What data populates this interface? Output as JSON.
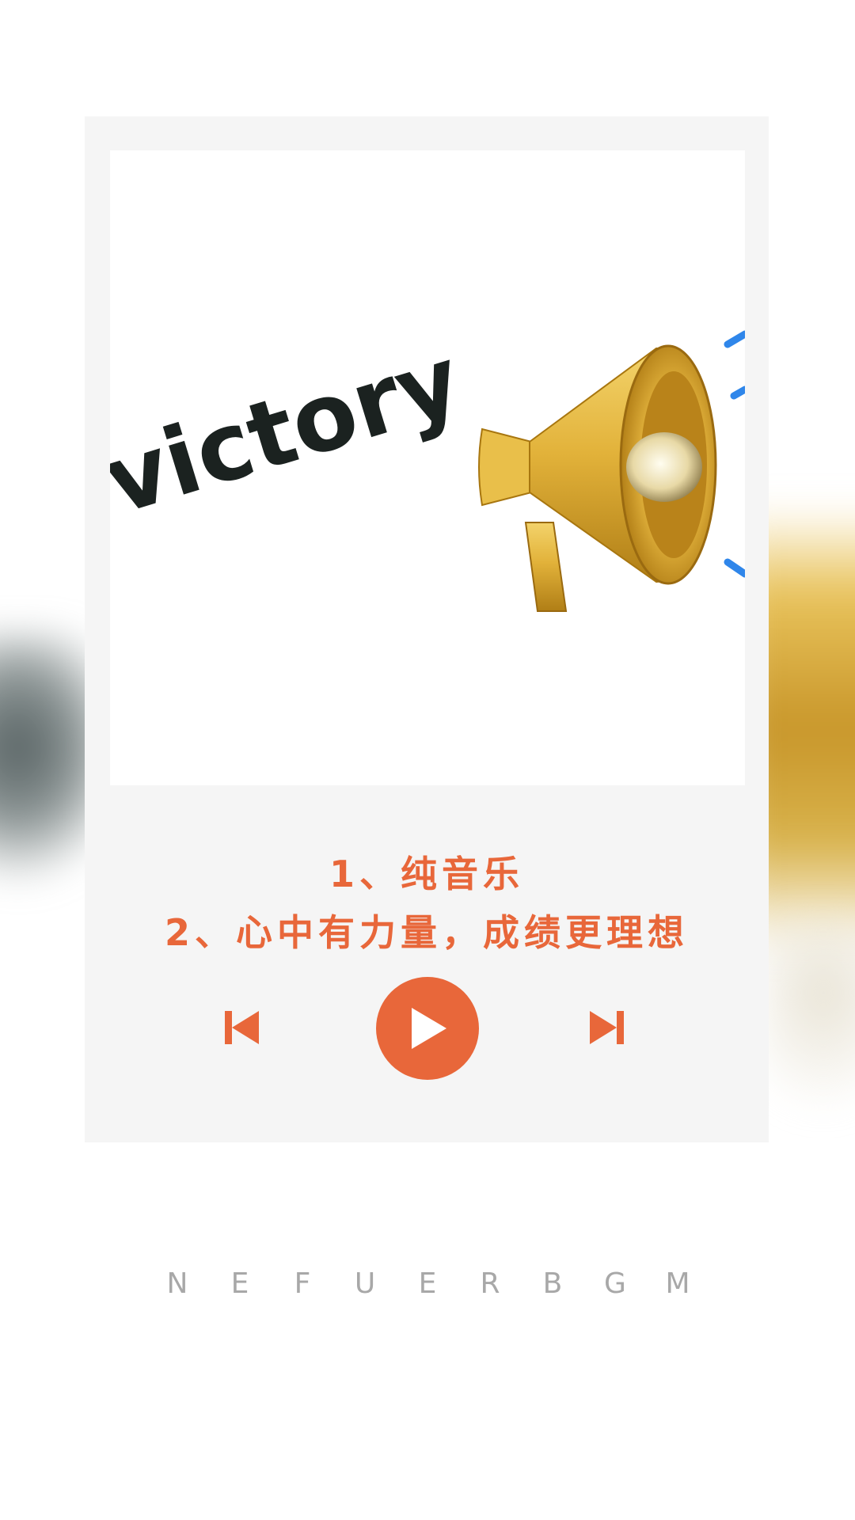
{
  "album": {
    "art_word": "victory",
    "art_icon": "megaphone-icon"
  },
  "song": {
    "line1": "1、纯音乐",
    "line2": "2、心中有力量，成绩更理想"
  },
  "controls": {
    "prev_icon": "skip-previous-icon",
    "play_icon": "play-icon",
    "next_icon": "skip-next-icon"
  },
  "footer": {
    "letters": [
      "N",
      "E",
      "F",
      "U",
      "E",
      "R",
      "B",
      "G",
      "M"
    ]
  },
  "colors": {
    "accent": "#e8673a",
    "card_bg": "#f5f5f5",
    "footer_text": "#a8a8a8"
  }
}
